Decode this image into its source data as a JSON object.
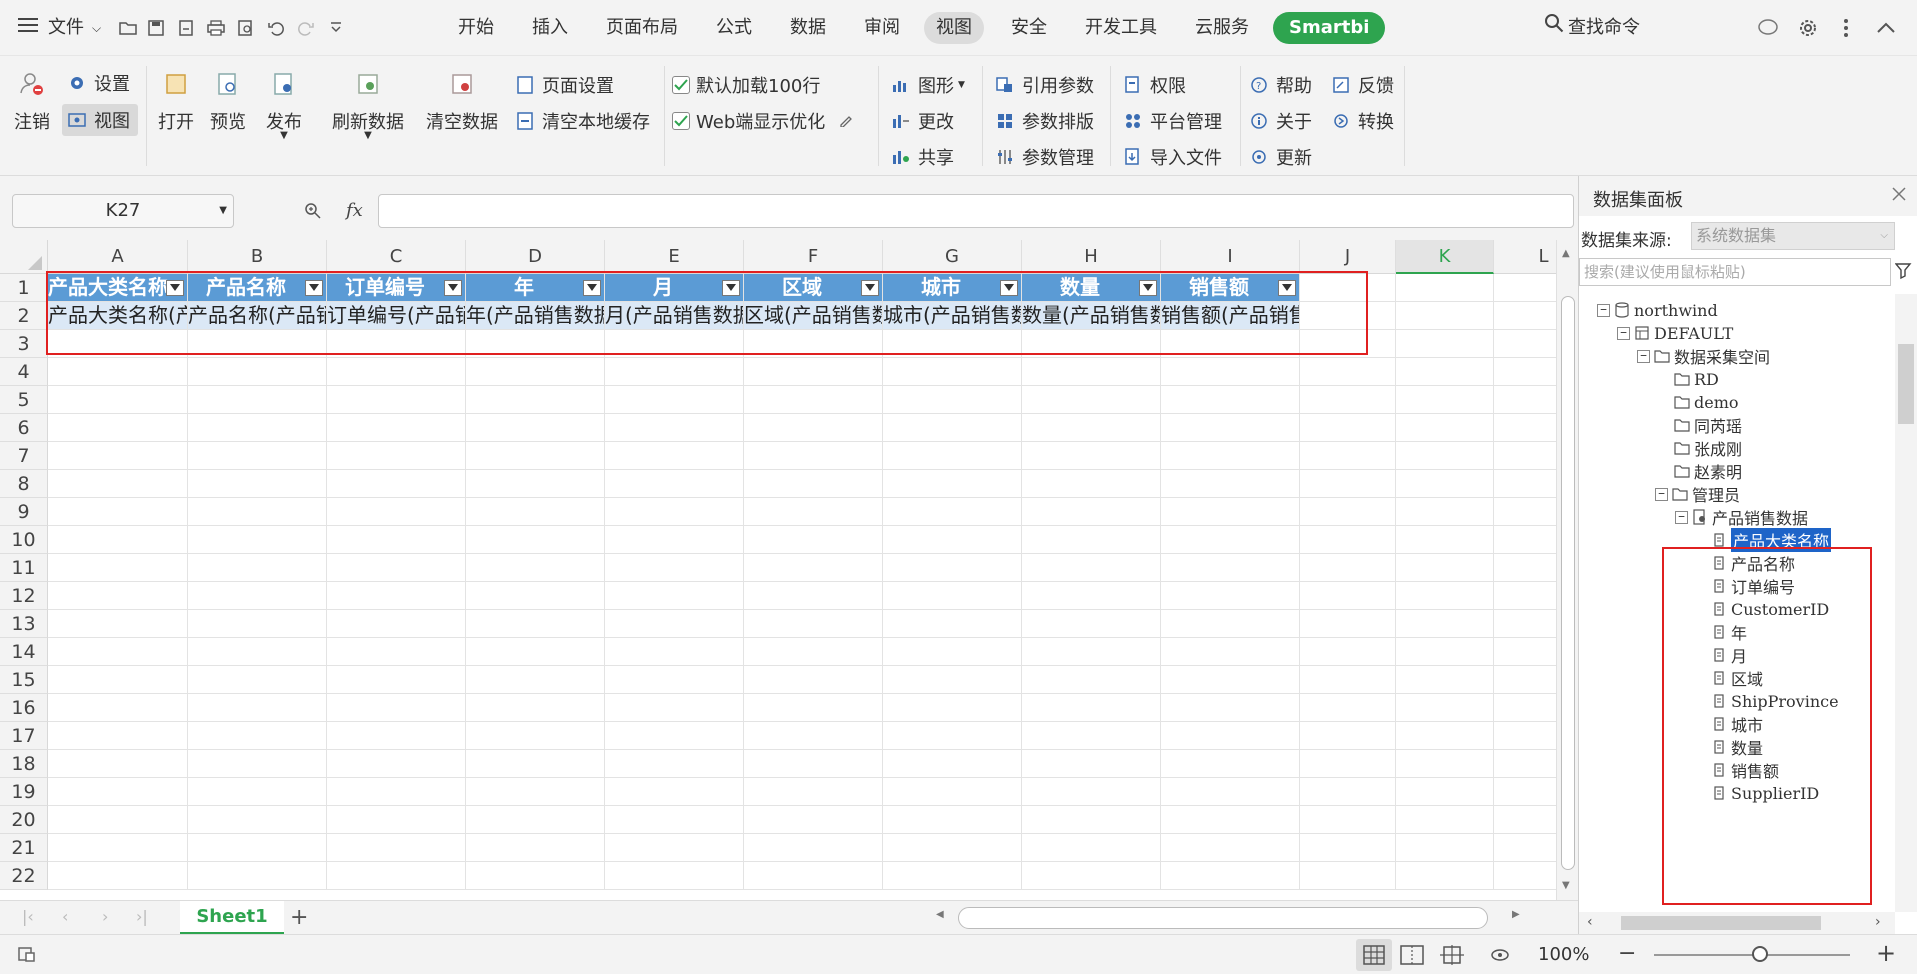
{
  "menubar": {
    "file_label": "文件",
    "tabs": [
      "开始",
      "插入",
      "页面布局",
      "公式",
      "数据",
      "审阅",
      "视图",
      "安全",
      "开发工具",
      "云服务",
      "Smartbi"
    ],
    "active_tab": "视图",
    "search_label": "查找命令"
  },
  "ribbon": {
    "logout": "注销",
    "settings": "设置",
    "view": "视图",
    "open": "打开",
    "preview": "预览",
    "publish": "发布",
    "refresh": "刷新数据",
    "clear": "清空数据",
    "page_setup": "页面设置",
    "clear_cache": "清空本地缓存",
    "load100": "默认加载100行",
    "web_opt": "Web端显示优化",
    "chart": "图形",
    "change": "更改",
    "share": "共享",
    "ref_param": "引用参数",
    "param_layout": "参数排版",
    "param_manage": "参数管理",
    "permission": "权限",
    "platform": "平台管理",
    "import": "导入文件",
    "help": "帮助",
    "about": "关于",
    "update": "更新",
    "feedback": "反馈",
    "convert": "转换"
  },
  "formula": {
    "cell_ref": "K27",
    "fx": "fx"
  },
  "grid": {
    "columns": [
      "A",
      "B",
      "C",
      "D",
      "E",
      "F",
      "G",
      "H",
      "I",
      "J",
      "K",
      "L"
    ],
    "selected_column": "K",
    "rows": [
      "1",
      "2",
      "3",
      "4",
      "5",
      "6",
      "7",
      "8",
      "9",
      "10",
      "11",
      "12",
      "13",
      "14",
      "15",
      "16",
      "17",
      "18",
      "19",
      "20",
      "21",
      "22"
    ],
    "header_cells": [
      "产品大类名称",
      "产品名称",
      "订单编号",
      "年",
      "月",
      "区域",
      "城市",
      "数量",
      "销售额"
    ],
    "data_cells": [
      "产品大类名称(产品销售数据)",
      "产品名称(产品销售数据)",
      "订单编号(产品销售数据)",
      "年(产品销售数据)",
      "月(产品销售数据)",
      "区域(产品销售数据)",
      "城市(产品销售数据)",
      "数量(产品销售数据)",
      "销售额(产品销售数据)"
    ]
  },
  "sheets": {
    "active": "Sheet1"
  },
  "status": {
    "zoom": "100%"
  },
  "panel": {
    "title": "数据集面板",
    "source_label": "数据集来源:",
    "source_value": "系统数据集",
    "search_placeholder": "搜索(建议使用鼠标粘贴)",
    "tree": {
      "db": "northwind",
      "schema": "DEFAULT",
      "space": "数据采集空间",
      "folders": [
        "RD",
        "demo",
        "同芮瑶",
        "张成刚",
        "赵素明",
        "管理员"
      ],
      "dataset": "产品销售数据",
      "fields": [
        "产品大类名称",
        "产品名称",
        "订单编号",
        "CustomerID",
        "年",
        "月",
        "区域",
        "ShipProvince",
        "城市",
        "数量",
        "销售额",
        "SupplierID"
      ],
      "selected_field": "产品大类名称"
    }
  },
  "colors": {
    "accent": "#2ea44f",
    "header_fill": "#5b9bd5",
    "data_fill": "#dbe8f6",
    "highlight_box": "#e02020",
    "tree_select": "#1e64c8"
  }
}
